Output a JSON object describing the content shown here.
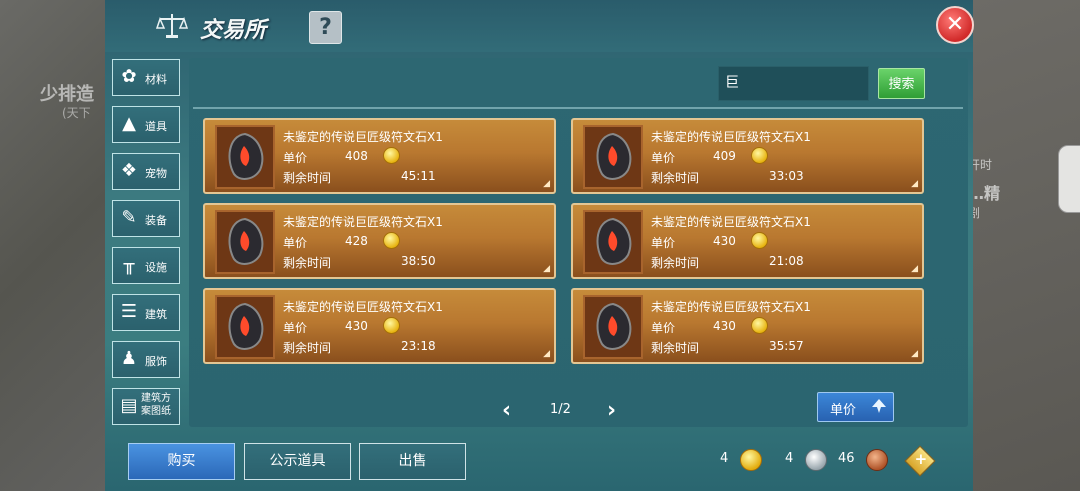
{
  "background": {
    "left_text": "少排造",
    "left_sub": "(天下",
    "right_text1": "开时",
    "right_text2": "…精",
    "right_text3": "剧"
  },
  "header": {
    "title": "交易所",
    "help_label": "?",
    "close_label": "✕"
  },
  "sidebar": {
    "items": [
      {
        "label": "材料",
        "icon": "flower-icon"
      },
      {
        "label": "道具",
        "icon": "flask-icon"
      },
      {
        "label": "宠物",
        "icon": "paw-icon"
      },
      {
        "label": "装备",
        "icon": "sword-icon"
      },
      {
        "label": "设施",
        "icon": "table-icon"
      },
      {
        "label": "建筑",
        "icon": "brick-icon"
      },
      {
        "label": "服饰",
        "icon": "clothes-icon"
      },
      {
        "label": "建筑方案图纸",
        "label_line1": "建筑方",
        "label_line2": "案图纸",
        "icon": "blueprint-icon"
      }
    ]
  },
  "search": {
    "value": "巨",
    "button_label": "搜索"
  },
  "listings": [
    {
      "name": "未鉴定的传说巨匠级符文石X1",
      "price_label": "单价",
      "price": "408",
      "time_label": "剩余时间",
      "time": "45:11"
    },
    {
      "name": "未鉴定的传说巨匠级符文石X1",
      "price_label": "单价",
      "price": "409",
      "time_label": "剩余时间",
      "time": "33:03"
    },
    {
      "name": "未鉴定的传说巨匠级符文石X1",
      "price_label": "单价",
      "price": "428",
      "time_label": "剩余时间",
      "time": "38:50"
    },
    {
      "name": "未鉴定的传说巨匠级符文石X1",
      "price_label": "单价",
      "price": "430",
      "time_label": "剩余时间",
      "time": "21:08"
    },
    {
      "name": "未鉴定的传说巨匠级符文石X1",
      "price_label": "单价",
      "price": "430",
      "time_label": "剩余时间",
      "time": "23:18"
    },
    {
      "name": "未鉴定的传说巨匠级符文石X1",
      "price_label": "单价",
      "price": "430",
      "time_label": "剩余时间",
      "time": "35:57"
    }
  ],
  "pager": {
    "text": "1/2",
    "prev": "‹",
    "next": "›"
  },
  "sort": {
    "label": "单价"
  },
  "bottom": {
    "buy_label": "购买",
    "public_label": "公示道具",
    "sell_label": "出售"
  },
  "currency": {
    "gold": "4",
    "silver": "4",
    "bronze": "46"
  },
  "colors": {
    "panel": "#3b7d80",
    "card": "#b97830",
    "buy_button": "#2b68b8",
    "search_button": "#2f9e35",
    "close_button": "#d12a2a"
  }
}
